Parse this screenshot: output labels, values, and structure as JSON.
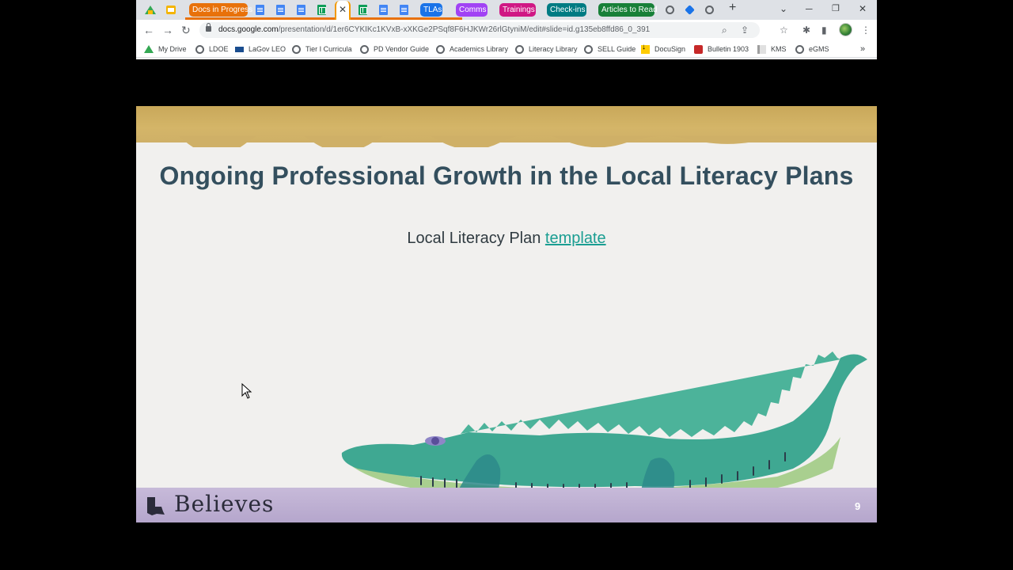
{
  "browser": {
    "tab_groups": [
      {
        "label": "Docs in Progress",
        "color": "#e8710a"
      },
      {
        "label": "TLAs",
        "color": "#1a73e8"
      },
      {
        "label": "Comms",
        "color": "#a142f4"
      },
      {
        "label": "Trainings",
        "color": "#d01884"
      },
      {
        "label": "Check-ins",
        "color": "#007b83"
      },
      {
        "label": "Articles to Read",
        "color": "#188038"
      }
    ],
    "tab_icons": [
      "drive-icon",
      "slides-icon",
      "docs-icon",
      "docs-icon",
      "docs-icon",
      "sheets-icon",
      "sheets-icon",
      "docs-icon",
      "docs-icon",
      "globe-icon",
      "diamond-icon",
      "globe-icon"
    ],
    "active_tab_close": "✕",
    "new_tab": "+",
    "url": {
      "host": "docs.google.com",
      "path": "/presentation/d/1er6CYKIKc1KVxB-xXKGe2PSqf8F6HJKWr26rlGtyniM/edit#slide=id.g135eb8ffd86_0_391"
    },
    "bookmarks": [
      {
        "label": "My Drive",
        "icon": "drive-icon"
      },
      {
        "label": "LDOE",
        "icon": "globe-icon"
      },
      {
        "label": "LaGov LEO",
        "icon": "leo-icon"
      },
      {
        "label": "Tier I Curricula",
        "icon": "globe-icon"
      },
      {
        "label": "PD Vendor Guide",
        "icon": "globe-icon"
      },
      {
        "label": "Academics Library",
        "icon": "globe-icon"
      },
      {
        "label": "Literacy Library",
        "icon": "globe-icon"
      },
      {
        "label": "SELL Guide",
        "icon": "globe-icon"
      },
      {
        "label": "DocuSign",
        "icon": "docusign-icon"
      },
      {
        "label": "Bulletin 1903",
        "icon": "pdf-icon"
      },
      {
        "label": "KMS",
        "icon": "kms-icon"
      },
      {
        "label": "eGMS",
        "icon": "globe-icon"
      }
    ],
    "bookmarks_overflow": "»"
  },
  "slide": {
    "title": "Ongoing Professional Growth in the Local Literacy Plans",
    "body_text": "Local Literacy Plan ",
    "link_text": "template",
    "footer_brand": "Believes",
    "slide_number": "9"
  },
  "colors": {
    "title": "#344f5e",
    "link": "#1b9e92",
    "gold_band": "#cfb067",
    "purple_band": "#b9aad0",
    "gator": "#3fa892"
  }
}
